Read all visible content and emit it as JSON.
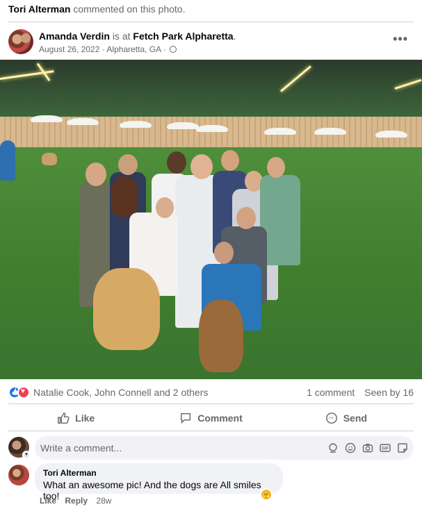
{
  "activity": {
    "actor": "Tori Alterman",
    "text": "commented on this photo."
  },
  "post": {
    "author": "Amanda Verdin",
    "is_at": "is at",
    "place": "Fetch Park Alpharetta",
    "period": ".",
    "date": "August 26, 2022",
    "separator": "·",
    "location": "Alpharetta, GA",
    "privacy_icon": "globe-icon",
    "more_label": "•••"
  },
  "reactions": {
    "icons": [
      "like-reaction-icon",
      "love-reaction-icon"
    ],
    "names": "Natalie Cook, John Connell and 2 others",
    "comments": "1 comment",
    "seen": "Seen by 16"
  },
  "actions": {
    "like": "Like",
    "comment": "Comment",
    "send": "Send"
  },
  "composer": {
    "placeholder": "Write a comment...",
    "icons": [
      "avatar-sticker-icon",
      "emoji-icon",
      "camera-icon",
      "gif-icon",
      "sticker-icon"
    ],
    "gif_label": "GIF"
  },
  "comment": {
    "name": "Tori Alterman",
    "text": "What an awesome pic! And the dogs are All smiles too!",
    "like": "Like",
    "reply": "Reply",
    "time": "28w"
  },
  "colors": {
    "accent": "#1877f2",
    "love": "#f33e58",
    "secondary_text": "#65676b",
    "bubble": "#f0f2f5"
  }
}
